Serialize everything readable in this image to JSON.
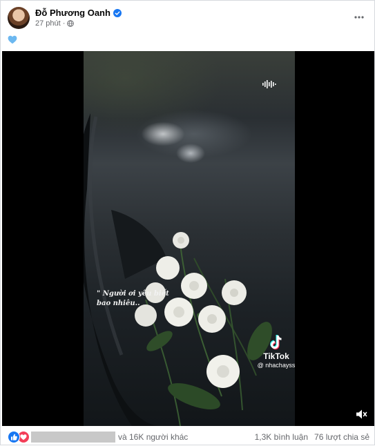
{
  "post": {
    "author_name": "Đỗ Phương Oanh",
    "time": "27 phút",
    "separator": "·",
    "caption_emoji": "blue-heart",
    "more_icon": "more-horizontal-icon"
  },
  "video": {
    "overlay_quote": "\" Người ơi yêu biết bao nhiêu..",
    "tiktok_brand": "TikTok",
    "tiktok_user": "@ nhachayss",
    "sound_icon": "sound-wave-icon",
    "mute_icon": "speaker-mute-icon"
  },
  "footer": {
    "others_text": "và 16K người khác",
    "comments_text": "1,3K bình luận",
    "shares_text": "76 lượt chia sẻ"
  },
  "colors": {
    "verified": "#1877f2",
    "like": "#1877f2",
    "love": "#f33e58",
    "secondary_text": "#65676b"
  }
}
